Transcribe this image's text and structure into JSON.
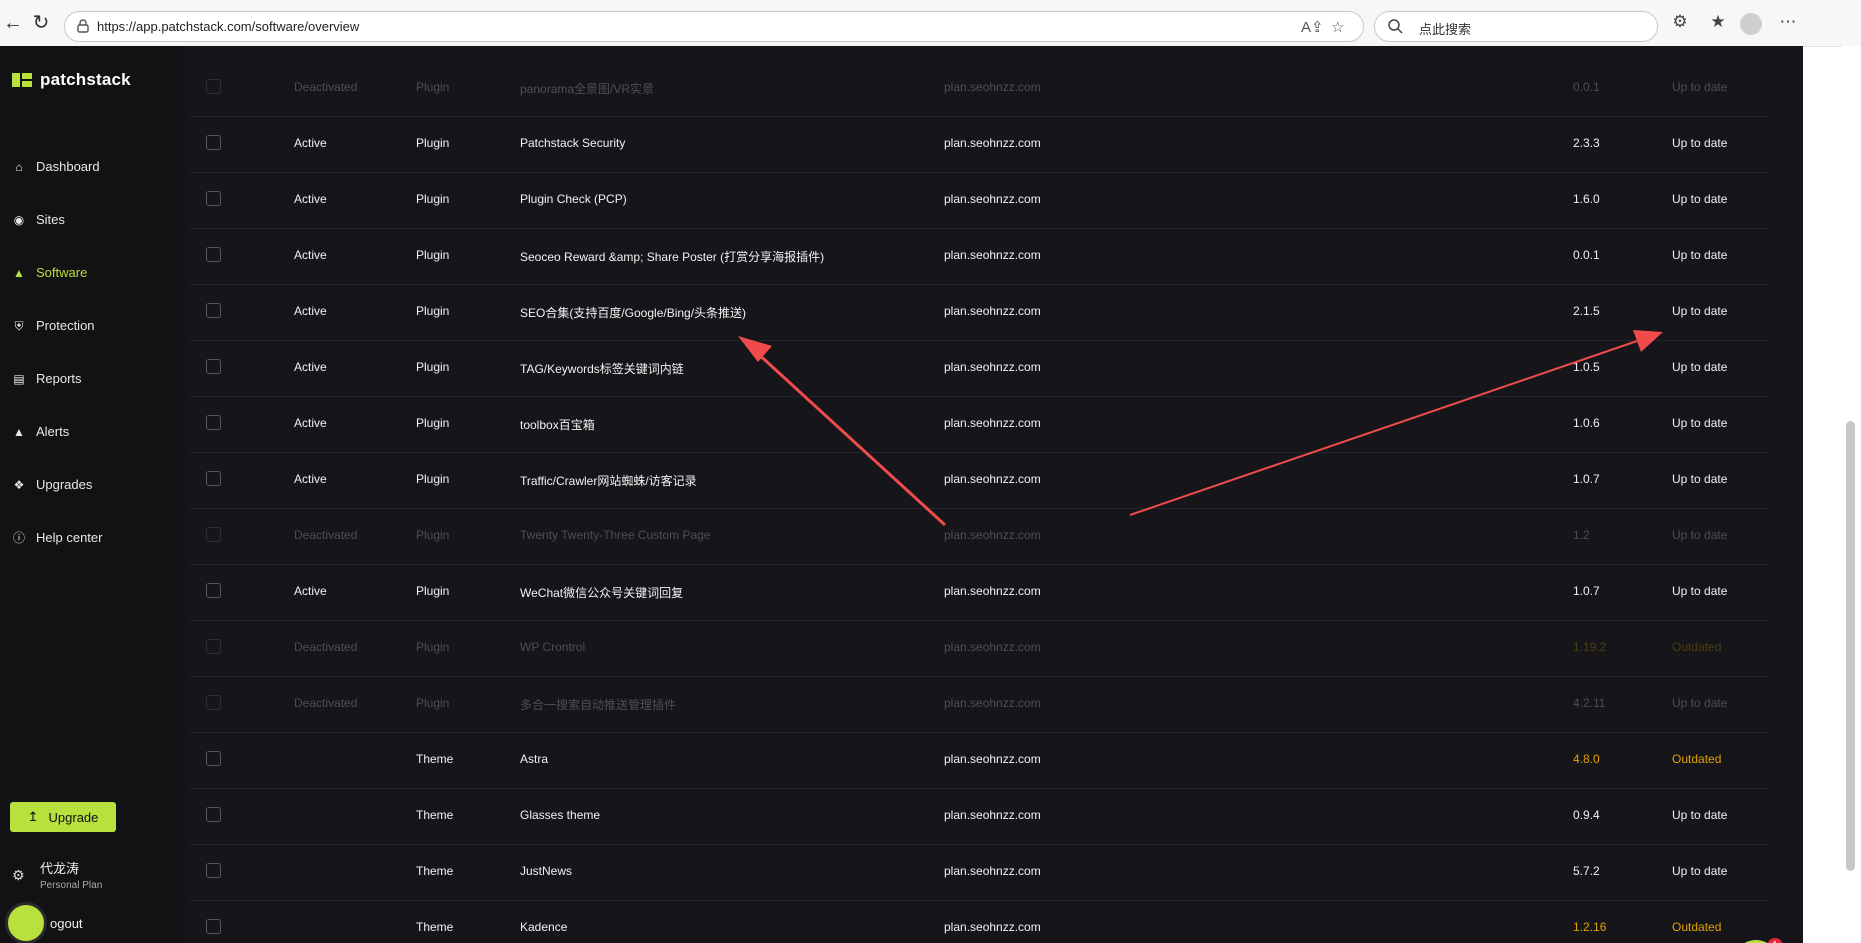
{
  "browser": {
    "url": "https://app.patchstack.com/software/overview",
    "search_placeholder": "点此搜索"
  },
  "app": {
    "brand": "patchstack",
    "nav": [
      {
        "label": "Dashboard",
        "icon": "home-icon"
      },
      {
        "label": "Sites",
        "icon": "globe-icon"
      },
      {
        "label": "Software",
        "icon": "shapes-icon"
      },
      {
        "label": "Protection",
        "icon": "shield-icon"
      },
      {
        "label": "Reports",
        "icon": "report-icon"
      },
      {
        "label": "Alerts",
        "icon": "warning-icon"
      },
      {
        "label": "Upgrades",
        "icon": "puzzle-icon"
      },
      {
        "label": "Help center",
        "icon": "info-icon"
      }
    ],
    "active_nav": "Software",
    "upgrade_label": "Upgrade",
    "user": {
      "name": "代龙涛",
      "plan": "Personal Plan"
    },
    "logout_label": "ogout",
    "chat_badge": "1",
    "accent_color": "#b8e13e",
    "outdated_color": "#e0a200"
  },
  "rows": [
    {
      "status": "Deactivated",
      "type": "Plugin",
      "name": "panorama全景图/VR实景",
      "site": "plan.seohnzz.com",
      "version": "0.0.1",
      "update": "Up to date",
      "dim": true
    },
    {
      "status": "Active",
      "type": "Plugin",
      "name": "Patchstack Security",
      "site": "plan.seohnzz.com",
      "version": "2.3.3",
      "update": "Up to date"
    },
    {
      "status": "Active",
      "type": "Plugin",
      "name": "Plugin Check (PCP)",
      "site": "plan.seohnzz.com",
      "version": "1.6.0",
      "update": "Up to date"
    },
    {
      "status": "Active",
      "type": "Plugin",
      "name": "Seoceo Reward &amp; Share Poster (打赏分享海报插件)",
      "site": "plan.seohnzz.com",
      "version": "0.0.1",
      "update": "Up to date"
    },
    {
      "status": "Active",
      "type": "Plugin",
      "name": "SEO合集(支持百度/Google/Bing/头条推送)",
      "site": "plan.seohnzz.com",
      "version": "2.1.5",
      "update": "Up to date"
    },
    {
      "status": "Active",
      "type": "Plugin",
      "name": "TAG/Keywords标签关键词内链",
      "site": "plan.seohnzz.com",
      "version": "1.0.5",
      "update": "Up to date"
    },
    {
      "status": "Active",
      "type": "Plugin",
      "name": "toolbox百宝箱",
      "site": "plan.seohnzz.com",
      "version": "1.0.6",
      "update": "Up to date"
    },
    {
      "status": "Active",
      "type": "Plugin",
      "name": "Traffic/Crawler网站蜘蛛/访客记录",
      "site": "plan.seohnzz.com",
      "version": "1.0.7",
      "update": "Up to date"
    },
    {
      "status": "Deactivated",
      "type": "Plugin",
      "name": "Twenty Twenty-Three Custom Page",
      "site": "plan.seohnzz.com",
      "version": "1.2",
      "update": "Up to date",
      "dim": true
    },
    {
      "status": "Active",
      "type": "Plugin",
      "name": "WeChat微信公众号关键词回复",
      "site": "plan.seohnzz.com",
      "version": "1.0.7",
      "update": "Up to date"
    },
    {
      "status": "Deactivated",
      "type": "Plugin",
      "name": "WP Crontrol",
      "site": "plan.seohnzz.com",
      "version": "1.19.2",
      "update": "Outdated",
      "dim": true,
      "outdated": true
    },
    {
      "status": "Deactivated",
      "type": "Plugin",
      "name": "多合一搜索自动推送管理插件",
      "site": "plan.seohnzz.com",
      "version": "4.2.11",
      "update": "Up to date",
      "dim": true
    },
    {
      "status": "",
      "type": "Theme",
      "name": "Astra",
      "site": "plan.seohnzz.com",
      "version": "4.8.0",
      "update": "Outdated",
      "outdated": true
    },
    {
      "status": "",
      "type": "Theme",
      "name": "Glasses theme",
      "site": "plan.seohnzz.com",
      "version": "0.9.4",
      "update": "Up to date"
    },
    {
      "status": "",
      "type": "Theme",
      "name": "JustNews",
      "site": "plan.seohnzz.com",
      "version": "5.7.2",
      "update": "Up to date"
    },
    {
      "status": "",
      "type": "Theme",
      "name": "Kadence",
      "site": "plan.seohnzz.com",
      "version": "1.2.16",
      "update": "Outdated",
      "outdated": true
    }
  ],
  "annotation_color": "#ef4b4b"
}
